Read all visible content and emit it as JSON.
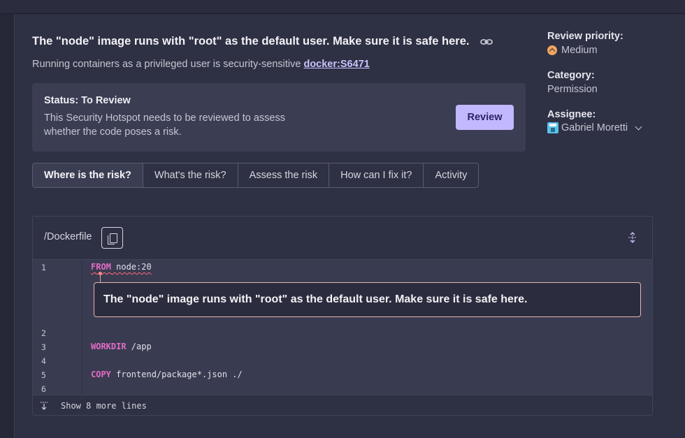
{
  "hotspot": {
    "title": "The \"node\" image runs with \"root\" as the default user. Make sure it is safe here.",
    "description": "Running containers as a privileged user is security-sensitive",
    "rule_key": "docker:S6471"
  },
  "status": {
    "title": "Status: To Review",
    "description": "This Security Hotspot needs to be reviewed to assess whether the code poses a risk.",
    "review_label": "Review"
  },
  "sidebar": {
    "priority_label": "Review priority:",
    "priority_value": "Medium",
    "category_label": "Category:",
    "category_value": "Permission",
    "assignee_label": "Assignee:",
    "assignee_value": "Gabriel Moretti"
  },
  "tabs": [
    {
      "label": "Where is the risk?",
      "active": true
    },
    {
      "label": "What's the risk?",
      "active": false
    },
    {
      "label": "Assess the risk",
      "active": false
    },
    {
      "label": "How can I fix it?",
      "active": false
    },
    {
      "label": "Activity",
      "active": false
    }
  ],
  "code": {
    "filename": "/Dockerfile",
    "line_numbers": [
      "1",
      "2",
      "3",
      "4",
      "5",
      "6"
    ],
    "lines": [
      {
        "keyword": "FROM",
        "rest": " node:20"
      },
      {
        "keyword": "WORKDIR",
        "rest": " /app"
      },
      {
        "keyword": "COPY",
        "rest": " frontend/package*.json ./"
      }
    ],
    "issue_message": "The \"node\" image runs with \"root\" as the default user. Make sure it is safe here.",
    "show_more": "Show 8 more lines"
  },
  "colors": {
    "background": "#262737",
    "panel": "#2e3043",
    "accent": "#c2b8ff",
    "keyword": "#e36cc7",
    "priority_medium": "#f0a463"
  },
  "icons": {
    "permalink": "link-icon",
    "priority": "chevron-up-circle-icon",
    "assignee_avatar": "avatar-icon",
    "assignee_dropdown": "chevron-down-icon",
    "copy": "copy-icon",
    "expand": "expand-icon",
    "show_more": "expand-down-icon"
  }
}
